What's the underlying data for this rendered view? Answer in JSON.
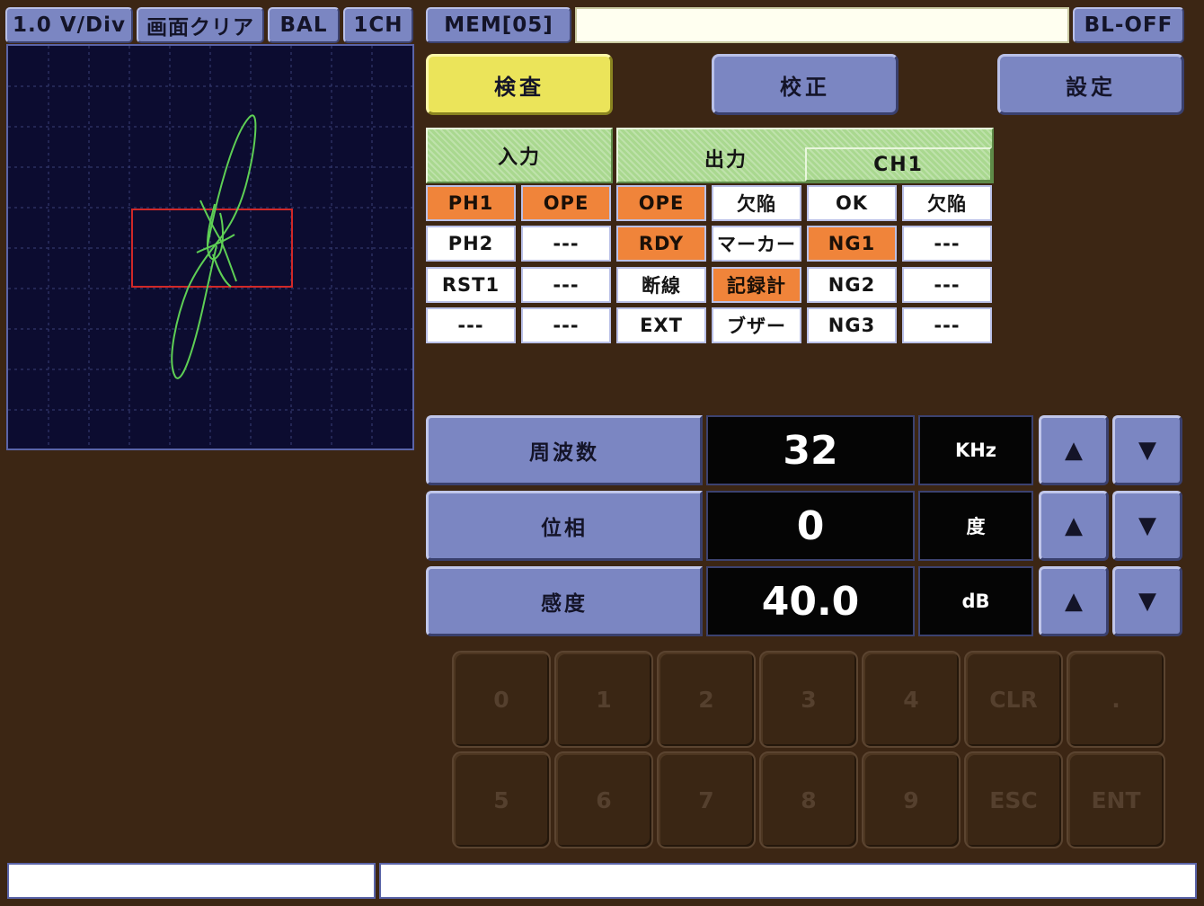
{
  "topbar": {
    "volt_div": "1.0 V/Div",
    "clear_screen": "画面クリア",
    "bal": "BAL",
    "channel": "1CH",
    "memory": "MEM[05]",
    "memory_name": "",
    "backlight": "BL-OFF"
  },
  "modes": {
    "inspect": "検査",
    "calibrate": "校正",
    "settings": "設定"
  },
  "io": {
    "input_header": "入力",
    "output_header": "出力",
    "channel_header": "CH1",
    "rows": [
      [
        "PH1",
        "OPE",
        "OPE",
        "欠陥",
        "OK",
        "欠陥"
      ],
      [
        "PH2",
        "---",
        "RDY",
        "マーカー",
        "NG1",
        "---"
      ],
      [
        "RST1",
        "---",
        "断線",
        "記録計",
        "NG2",
        "---"
      ],
      [
        "---",
        "---",
        "EXT",
        "ブザー",
        "NG3",
        "---"
      ]
    ],
    "active": [
      [
        true,
        true,
        true,
        false,
        false,
        false
      ],
      [
        false,
        false,
        true,
        false,
        true,
        false
      ],
      [
        false,
        false,
        false,
        true,
        false,
        false
      ],
      [
        false,
        false,
        false,
        false,
        false,
        false
      ]
    ]
  },
  "params": {
    "frequency": {
      "label": "周波数",
      "value": "32",
      "unit": "KHz"
    },
    "phase": {
      "label": "位相",
      "value": "0",
      "unit": "度"
    },
    "sensitivity": {
      "label": "感度",
      "value": "40.0",
      "unit": "dB"
    },
    "up_symbol": "▲",
    "down_symbol": "▼"
  },
  "keypad": {
    "row1": [
      "0",
      "1",
      "2",
      "3",
      "4",
      "CLR",
      "."
    ],
    "row2": [
      "5",
      "6",
      "7",
      "8",
      "9",
      "ESC",
      "ENT"
    ]
  },
  "status": {
    "left": "",
    "right": ""
  },
  "colors": {
    "background": "#3c2614",
    "button": "#7b86c2",
    "active_mode": "#ebe45a",
    "active_cell": "#f0843a",
    "trace": "#5ecf55",
    "gate": "#d02828",
    "scope_bg": "#0c0c30"
  }
}
